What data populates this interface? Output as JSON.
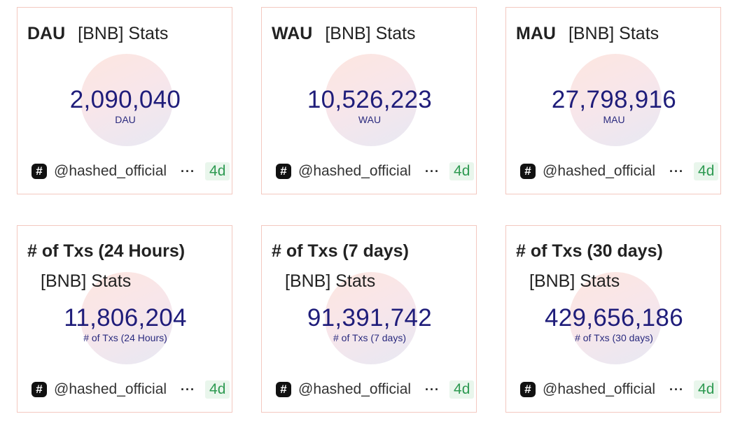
{
  "cards": [
    {
      "title": "DAU",
      "subtitle": "[BNB] Stats",
      "value": "2,090,040",
      "unit": "DAU",
      "author": "@hashed_official",
      "more": "···",
      "age": "4d"
    },
    {
      "title": "WAU",
      "subtitle": "[BNB] Stats",
      "value": "10,526,223",
      "unit": "WAU",
      "author": "@hashed_official",
      "more": "···",
      "age": "4d"
    },
    {
      "title": "MAU",
      "subtitle": "[BNB] Stats",
      "value": "27,798,916",
      "unit": "MAU",
      "author": "@hashed_official",
      "more": "···",
      "age": "4d"
    },
    {
      "title": "# of Txs (24 Hours)",
      "subtitle": "[BNB] Stats",
      "value": "11,806,204",
      "unit": "# of Txs (24 Hours)",
      "author": "@hashed_official",
      "more": "···",
      "age": "4d"
    },
    {
      "title": "# of Txs (7 days)",
      "subtitle": "[BNB] Stats",
      "value": "91,391,742",
      "unit": "# of Txs (7 days)",
      "author": "@hashed_official",
      "more": "···",
      "age": "4d"
    },
    {
      "title": "# of Txs (30 days)",
      "subtitle": "[BNB] Stats",
      "value": "429,656,186",
      "unit": "# of Txs (30 days)",
      "author": "@hashed_official",
      "more": "···",
      "age": "4d"
    }
  ],
  "icons": {
    "author": "hash-icon",
    "menu": "more-icon"
  },
  "colors": {
    "value": "#1f1d7a",
    "border": "#f3c8c0",
    "badge_bg": "#e9f6ec",
    "badge_text": "#2e9a52"
  }
}
